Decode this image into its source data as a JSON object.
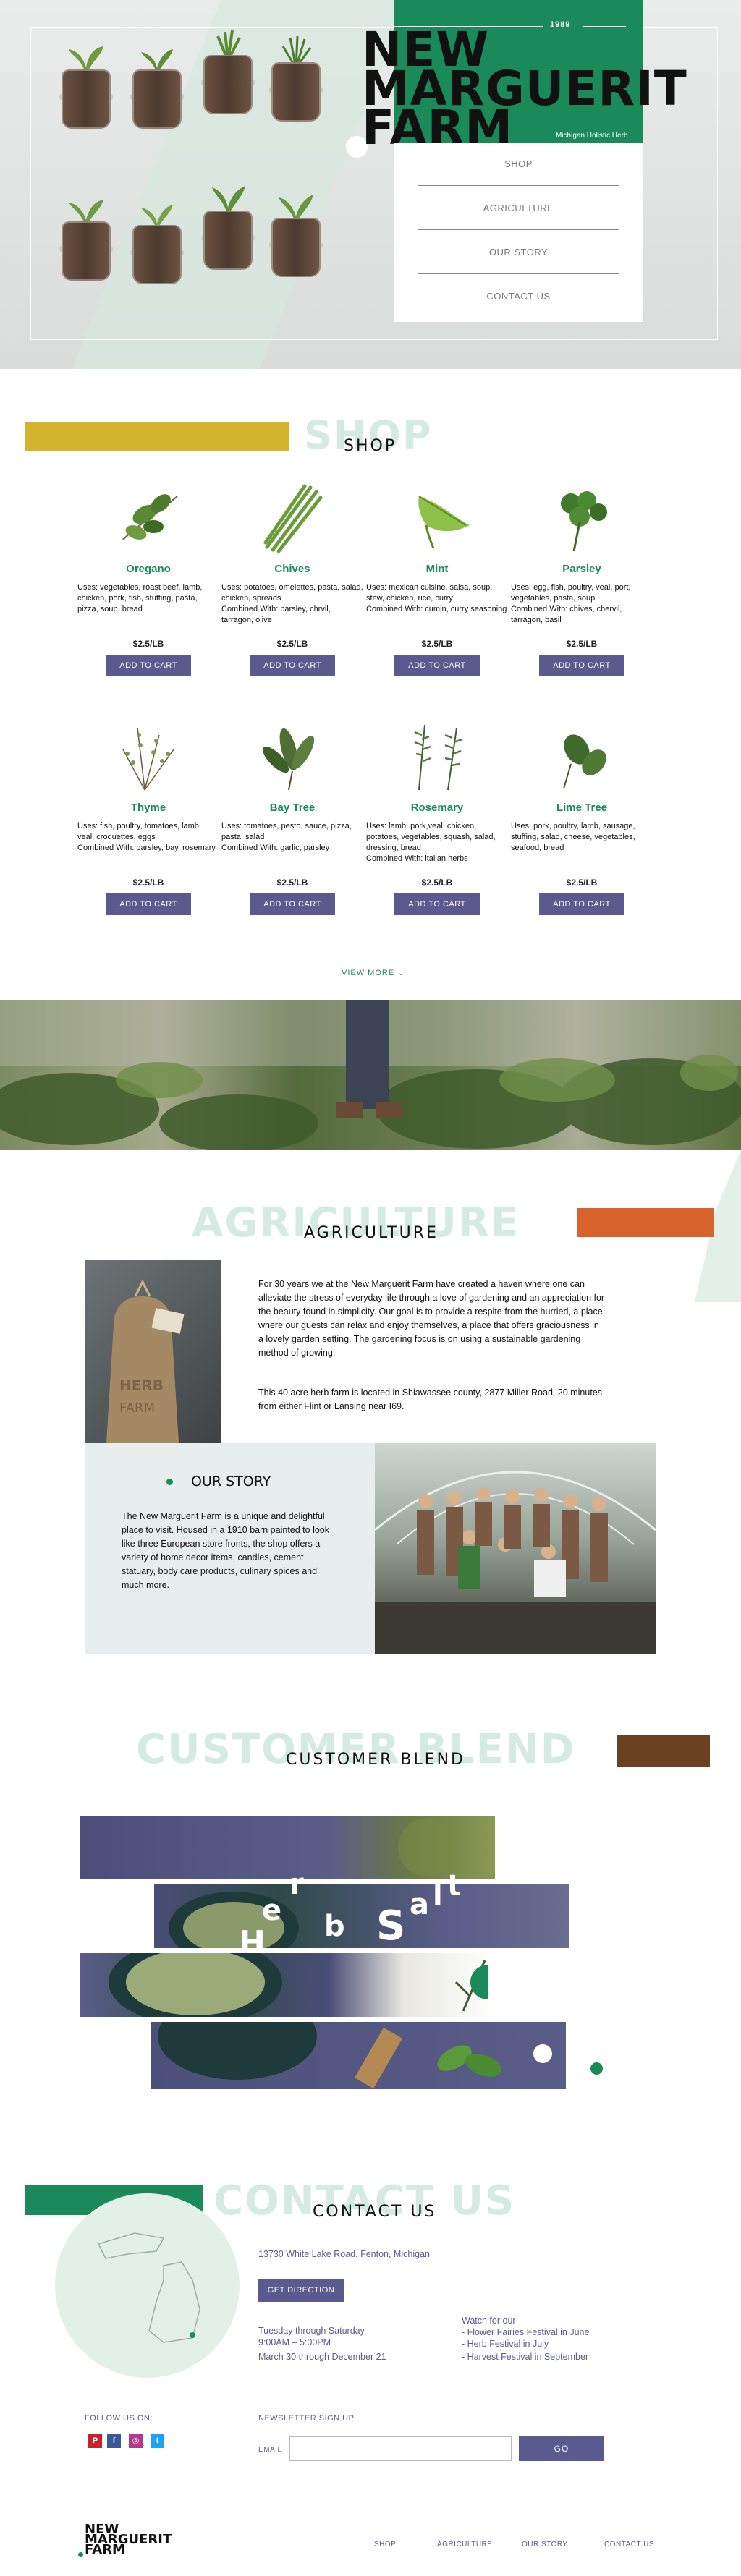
{
  "hero": {
    "year": "1989",
    "logo_line1": "NEW",
    "logo_line2": "MARGUERIT",
    "logo_line3": "FARM",
    "tagline": "Michigan Holistic Herb",
    "nav": [
      "SHOP",
      "AGRICULTURE",
      "OUR STORY",
      "CONTACT US"
    ]
  },
  "shop": {
    "ghost": "SHOP",
    "title": "SHOP",
    "view_more": "VIEW MORE",
    "products": [
      {
        "name": "Oregano",
        "uses": "Uses: vegetables, roast beef, lamb, chicken, pork, fish, stuffing, pasta, pizza, soup, bread",
        "price": "$2.5/LB",
        "button": "ADD TO CART"
      },
      {
        "name": "Chives",
        "uses": "Uses: potatoes, omelettes, pasta, salad, chicken, spreads\nCombined With: parsley, chrvil, tarragon, olive",
        "price": "$2.5/LB",
        "button": "ADD TO CART"
      },
      {
        "name": "Mint",
        "uses": "Uses: mexican cuisine, salsa, soup, stew, chicken, rice, curry\nCombined With: cumin, curry seasoning",
        "price": "$2.5/LB",
        "button": "ADD TO CART"
      },
      {
        "name": "Parsley",
        "uses": "Uses: egg, fish, poultry, veal, port, vegetables, pasta, soup\nCombined With: chives, chervil, tarragon, basil",
        "price": "$2.5/LB",
        "button": "ADD TO CART"
      },
      {
        "name": "Thyme",
        "uses": "Uses: fish, poultry, tomatoes, lamb, veal, croquettes, eggs\nCombined With: parsley, bay, rosemary",
        "price": "$2.5/LB",
        "button": "ADD TO CART"
      },
      {
        "name": "Bay Tree",
        "uses": "Uses: tomatoes, pesto, sauce, pizza, pasta, salad\nCombined With: garlic, parsley",
        "price": "$2.5/LB",
        "button": "ADD TO CART"
      },
      {
        "name": "Rosemary",
        "uses": "Uses: lamb, pork,veal, chicken, potatoes, vegetables, squash, salad, dressing, bread\nCombined With: italian herbs",
        "price": "$2.5/LB",
        "button": "ADD TO CART"
      },
      {
        "name": "Lime Tree",
        "uses": "Uses: pork, poultry, lamb, sausage, stuffing, salad, cheese, vegetables, seafood, bread",
        "price": "$2.5/LB",
        "button": "ADD TO CART"
      }
    ]
  },
  "agriculture": {
    "ghost": "AGRICULTURE",
    "title": "AGRICULTURE",
    "para1": "For 30 years we at the New Marguerit Farm have created a haven where one can alleviate the stress of everyday life through a love of gardening and an appreciation for the beauty found in simplicity. Our goal is to provide a respite from the hurried, a place where our guests can relax and enjoy themselves, a place that offers graciousness in a lovely garden setting. The gardening focus is on using a sustainable gardening method of growing.",
    "para2": "This 40 acre herb farm is located in Shiawassee county, 2877 Miller Road, 20 minutes from either Flint or Lansing near I69."
  },
  "story": {
    "title": "OUR STORY",
    "text": "The New Marguerit Farm is a unique and delightful place to visit. Housed in a 1910 barn painted to look like three European store fronts, the shop offers a variety of home decor items, candles, cement statuary, body care products, culinary spices and much more."
  },
  "blend": {
    "ghost": "CUSTOMER BLEND",
    "title": "CUSTOMER BLEND",
    "letters": [
      "H",
      "e",
      "r",
      "b",
      "S",
      "a",
      "l",
      "t"
    ]
  },
  "contact": {
    "ghost": "CONTACT US",
    "title": "CONTACT US",
    "address": "13730 White Lake Road, Fenton, Michigan",
    "direction_button": "GET DIRECTION",
    "hours1": "Tuesday through Saturday",
    "hours2": "9:00AM – 5:00PM",
    "hours3": "March 30 through December 21",
    "watch_title": "Watch for our",
    "events": [
      "- Flower Fairies Festival in June",
      "- Herb Festival in July",
      "- Harvest Festival in September"
    ],
    "follow": "FOLLOW US ON:",
    "newsletter": "NEWSLETTER SIGN UP",
    "email_label": "EMAIL",
    "email_placeholder": "",
    "go": "GO",
    "social": [
      "P",
      "f",
      "◎",
      "t"
    ]
  },
  "footer": {
    "logo_line1": "NEW",
    "logo_line2": "MARGUERIT",
    "logo_line3": "FARM",
    "links": [
      "SHOP",
      "AGRICULTURE",
      "OUR STORY",
      "CONTACT US"
    ]
  },
  "colors": {
    "green": "#1a8a5a",
    "purple": "#5b5a8e",
    "mustard": "#d4b42e",
    "orange": "#d9642b",
    "brown": "#6b4123",
    "mint": "#d3ebe2"
  }
}
